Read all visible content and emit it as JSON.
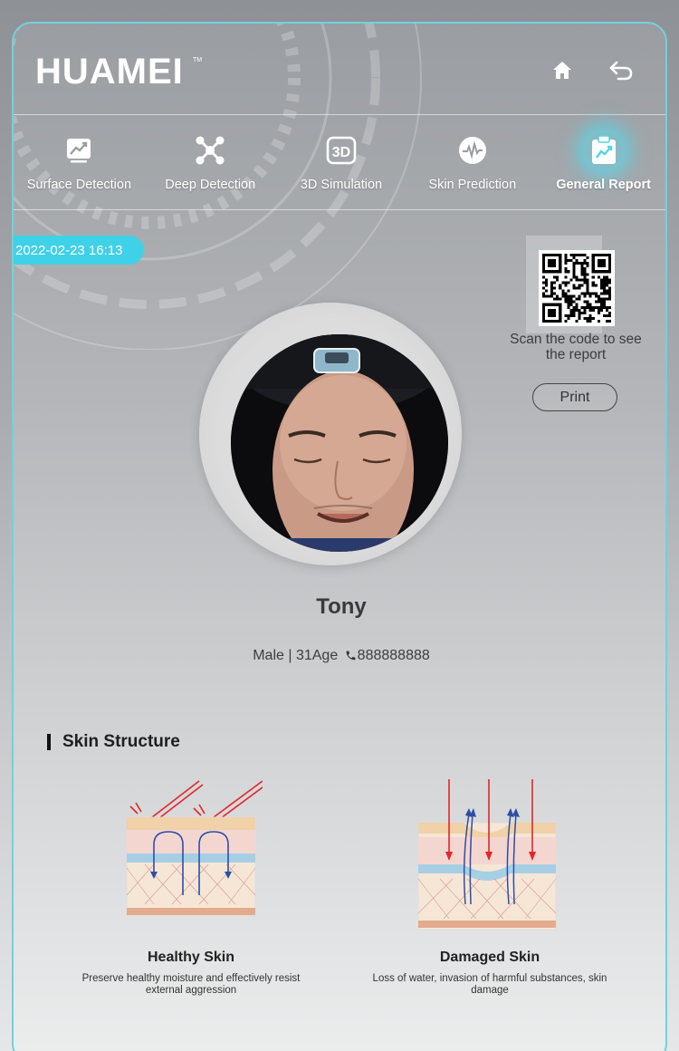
{
  "header": {
    "logo_text": "HUAMEI",
    "home_icon": "home-icon",
    "back_icon": "back-arrow-icon"
  },
  "nav": {
    "items": [
      {
        "label": "Surface Detection",
        "icon": "chart-trend-icon"
      },
      {
        "label": "Deep Detection",
        "icon": "molecule-icon"
      },
      {
        "label": "3D Simulation",
        "icon": "3d-icon"
      },
      {
        "label": "Skin Prediction",
        "icon": "pulse-icon"
      },
      {
        "label": "General Report",
        "icon": "report-clipboard-icon"
      }
    ],
    "active_index": 4
  },
  "report": {
    "datetime": "2022-02-23 16:13",
    "qr_caption": "Scan the code to see the report",
    "print_label": "Print"
  },
  "profile": {
    "name": "Tony",
    "details_prefix": "Male | 31Age",
    "phone": "888888888"
  },
  "skin_structure": {
    "title": "Skin Structure",
    "healthy": {
      "title": "Healthy Skin",
      "desc": "Preserve healthy moisture and effectively resist external aggression"
    },
    "damaged": {
      "title": "Damaged Skin",
      "desc": "Loss of water, invasion of harmful substances, skin damage"
    }
  },
  "colors": {
    "accent": "#3fd1e8",
    "frame_border": "#6fd3dc"
  }
}
